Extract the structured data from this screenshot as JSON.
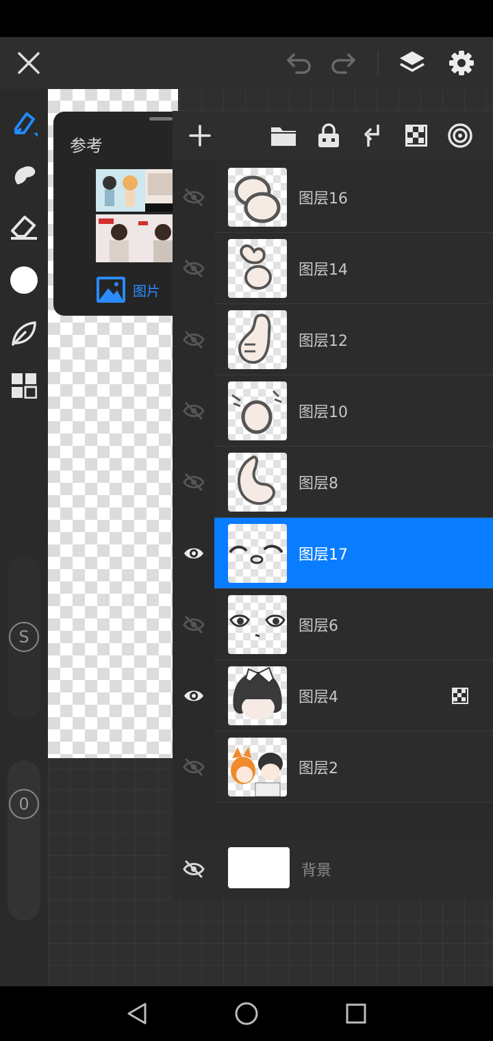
{
  "reference": {
    "title": "参考",
    "image_button_label": "图片"
  },
  "layers": [
    {
      "name": "图层16",
      "visible": false,
      "selected": false
    },
    {
      "name": "图层14",
      "visible": false,
      "selected": false
    },
    {
      "name": "图层12",
      "visible": false,
      "selected": false
    },
    {
      "name": "图层10",
      "visible": false,
      "selected": false
    },
    {
      "name": "图层8",
      "visible": false,
      "selected": false
    },
    {
      "name": "图层17",
      "visible": true,
      "selected": true
    },
    {
      "name": "图层6",
      "visible": false,
      "selected": false
    },
    {
      "name": "图层4",
      "visible": true,
      "selected": false,
      "alpha_locked": true
    },
    {
      "name": "图层2",
      "visible": false,
      "selected": false
    }
  ],
  "background_layer": {
    "name": "背景",
    "visible": false
  },
  "left_sliders": {
    "size_label": "S",
    "opacity_label": "0"
  },
  "colors": {
    "accent": "#0a7cff",
    "current_color": "#ffffff"
  }
}
